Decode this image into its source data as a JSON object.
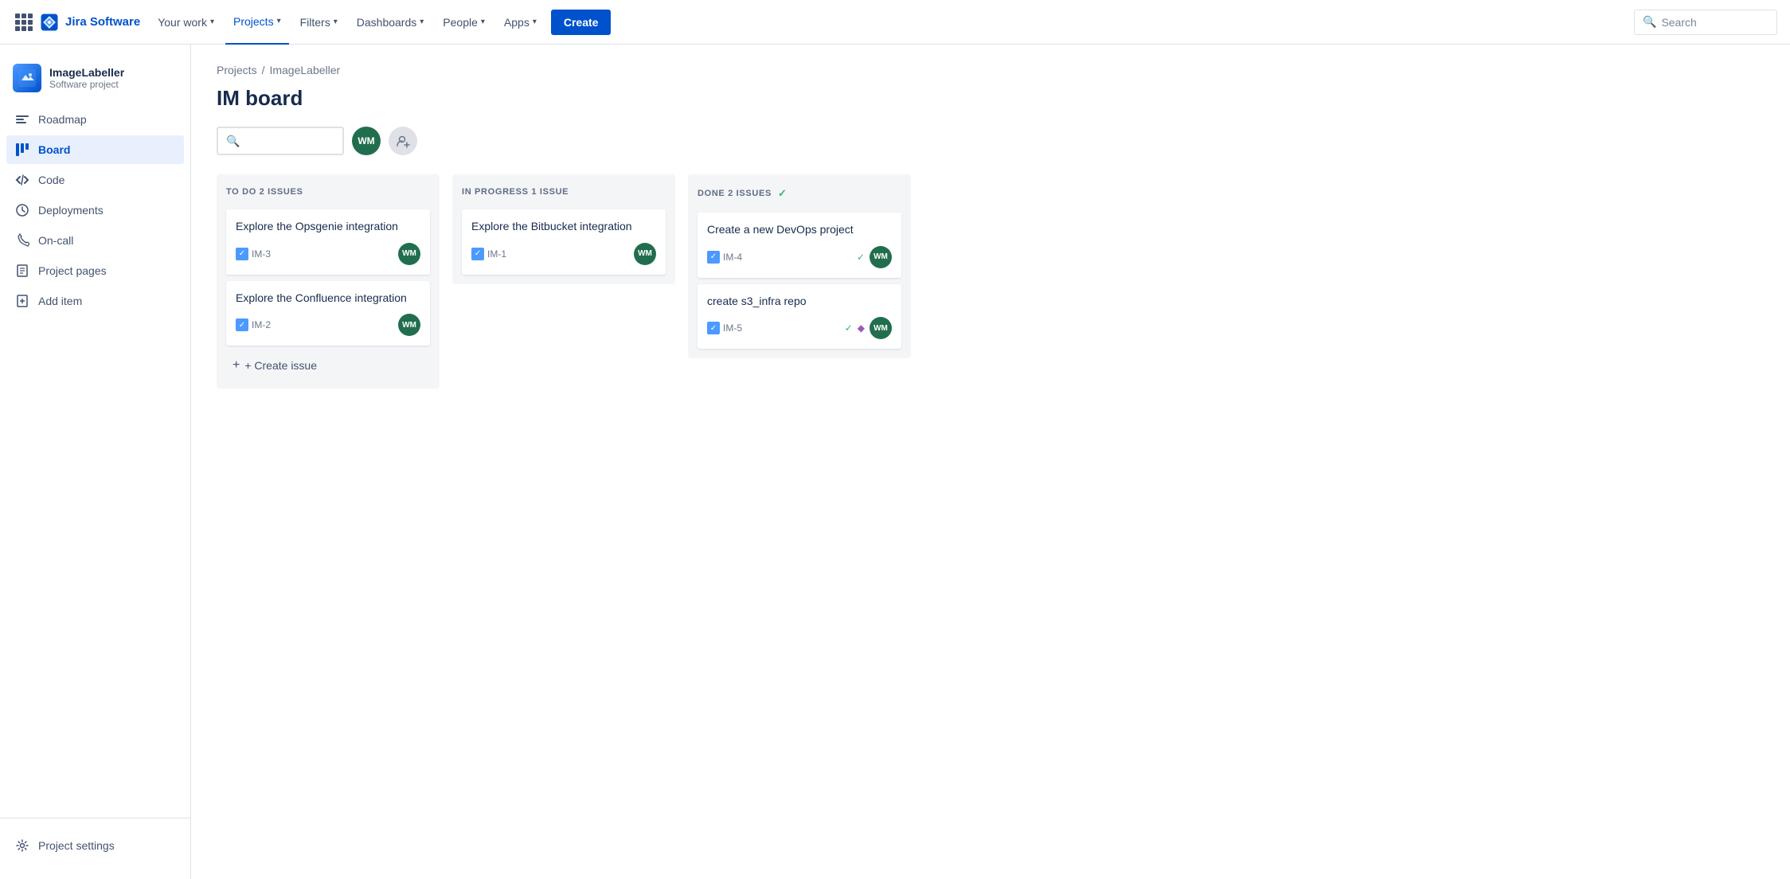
{
  "nav": {
    "your_work": "Your work",
    "projects": "Projects",
    "filters": "Filters",
    "dashboards": "Dashboards",
    "people": "People",
    "apps": "Apps",
    "create": "Create",
    "search_placeholder": "Search"
  },
  "sidebar": {
    "project_name": "ImageLabeller",
    "project_type": "Software project",
    "items": [
      {
        "id": "roadmap",
        "label": "Roadmap",
        "icon": "roadmap"
      },
      {
        "id": "board",
        "label": "Board",
        "icon": "board",
        "active": true
      },
      {
        "id": "code",
        "label": "Code",
        "icon": "code"
      },
      {
        "id": "deployments",
        "label": "Deployments",
        "icon": "deployments"
      },
      {
        "id": "oncall",
        "label": "On-call",
        "icon": "oncall"
      },
      {
        "id": "pages",
        "label": "Project pages",
        "icon": "pages"
      },
      {
        "id": "additem",
        "label": "Add item",
        "icon": "additem"
      }
    ],
    "settings_label": "Project settings"
  },
  "breadcrumb": {
    "projects_label": "Projects",
    "project_label": "ImageLabeller"
  },
  "board": {
    "title": "IM board",
    "columns": [
      {
        "id": "todo",
        "header": "TO DO 2 ISSUES",
        "cards": [
          {
            "id": "im3",
            "title": "Explore the Opsgenie integration",
            "ticket": "IM-3"
          },
          {
            "id": "im2",
            "title": "Explore the Confluence integration",
            "ticket": "IM-2"
          }
        ],
        "create_issue_label": "+ Create issue"
      },
      {
        "id": "inprogress",
        "header": "IN PROGRESS 1 ISSUE",
        "cards": [
          {
            "id": "im1",
            "title": "Explore the Bitbucket integration",
            "ticket": "IM-1"
          }
        ]
      },
      {
        "id": "done",
        "header": "DONE 2 ISSUES",
        "cards": [
          {
            "id": "im4",
            "title": "Create a new DevOps project",
            "ticket": "IM-4"
          },
          {
            "id": "im5",
            "title": "create s3_infra repo",
            "ticket": "IM-5"
          }
        ]
      }
    ],
    "avatar_initials": "WM"
  }
}
